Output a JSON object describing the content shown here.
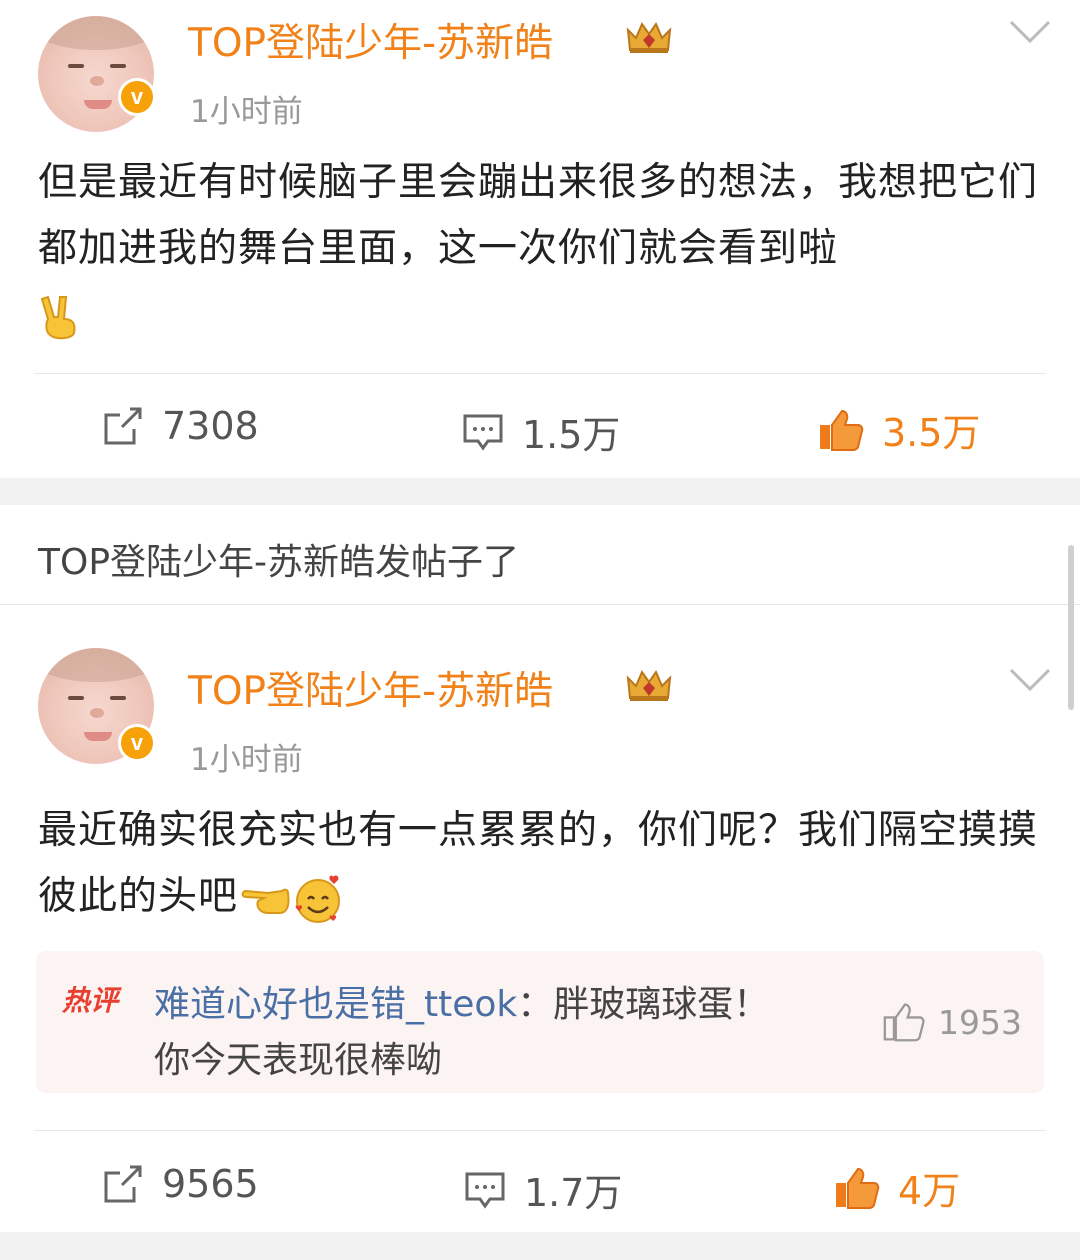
{
  "posts": [
    {
      "username": "TOP登陆少年-苏新皓",
      "time": "1小时前",
      "body": "但是最近有时候脑子里会蹦出来很多的想法，我想把它们都加进我的舞台里面，这一次你们就会看到啦",
      "emojis": [
        "victory-hand-emoji"
      ],
      "actions": {
        "repost": "7308",
        "comment": "1.5万",
        "like": "3.5万"
      }
    },
    {
      "username": "TOP登陆少年-苏新皓",
      "time": "1小时前",
      "body": "最近确实很充实也有一点累累的，你们呢？我们隔空摸摸彼此的头吧",
      "emojis": [
        "pointing-hand-emoji",
        "smiling-face-with-hearts-emoji"
      ],
      "hot_comment": {
        "tag": "热评",
        "user": "难道心好也是错_tteok",
        "separator": "：",
        "text_line1": "胖玻璃球蛋！",
        "text_line2": "你今天表现很棒呦",
        "likes": "1953"
      },
      "actions": {
        "repost": "9565",
        "comment": "1.7万",
        "like": "4万"
      }
    }
  ],
  "section_header": "TOP登陆少年-苏新皓发帖子了",
  "colors": {
    "accent": "#f08219",
    "hot_tag": "#e8402f",
    "link": "#4a6fa5",
    "divider_bg": "#f2f2f2"
  }
}
